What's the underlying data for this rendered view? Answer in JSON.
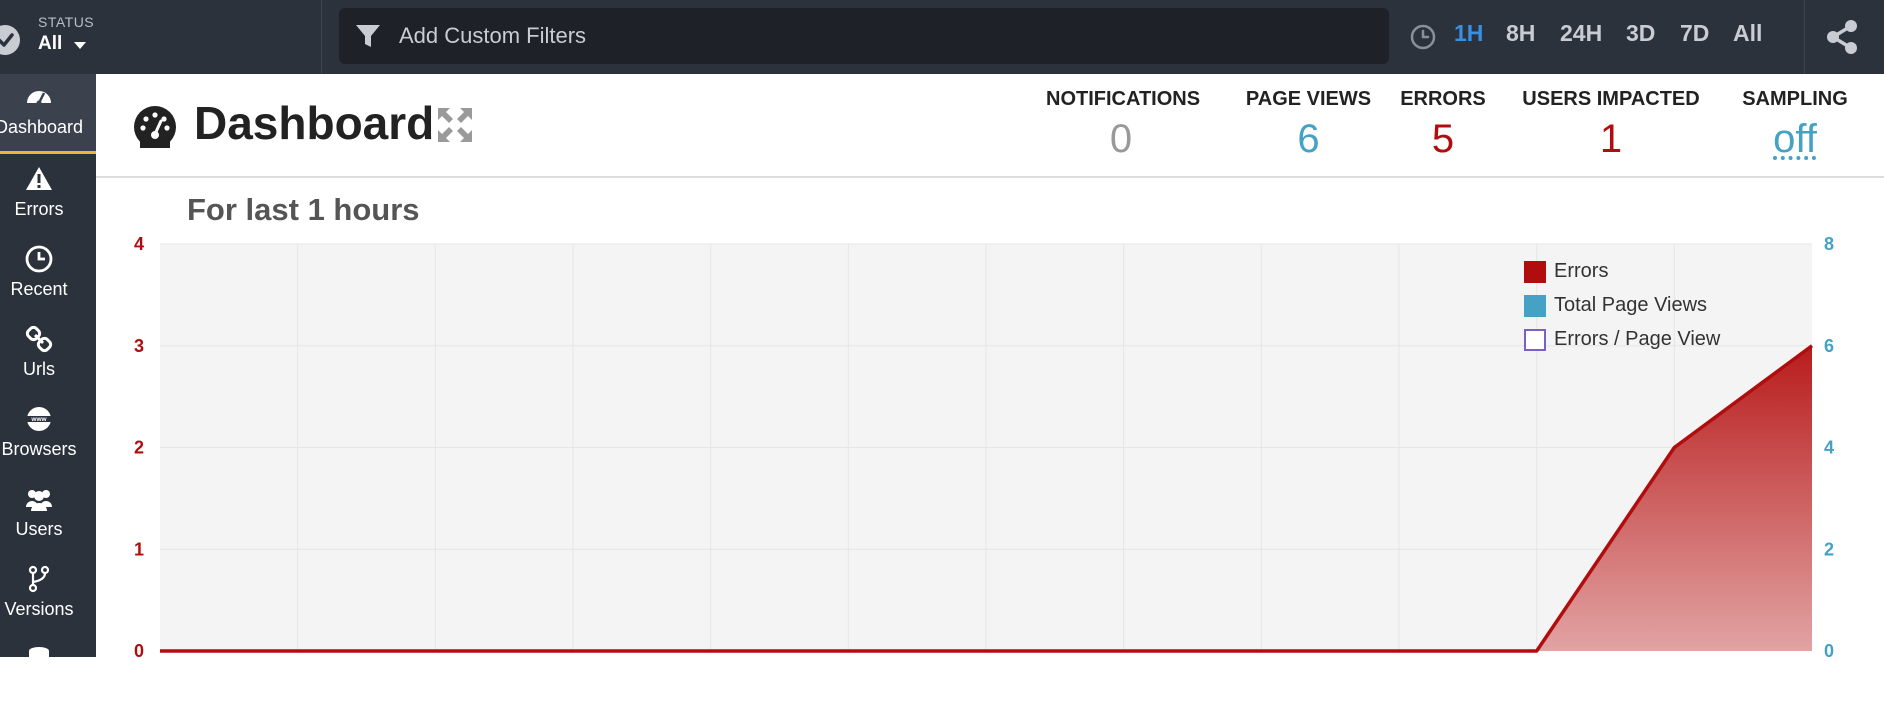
{
  "status": {
    "label": "STATUS",
    "value": "All"
  },
  "filter": {
    "placeholder": "Add Custom Filters"
  },
  "time_ranges": [
    {
      "label": "1H",
      "active": true
    },
    {
      "label": "8H",
      "active": false
    },
    {
      "label": "24H",
      "active": false
    },
    {
      "label": "3D",
      "active": false
    },
    {
      "label": "7D",
      "active": false
    },
    {
      "label": "All",
      "active": false
    }
  ],
  "sidebar": {
    "items": [
      {
        "label": "Dashboard",
        "icon": "gauge-icon",
        "active": true
      },
      {
        "label": "Errors",
        "icon": "warning-icon",
        "active": false
      },
      {
        "label": "Recent",
        "icon": "clock-icon",
        "active": false
      },
      {
        "label": "Urls",
        "icon": "link-icon",
        "active": false
      },
      {
        "label": "Browsers",
        "icon": "www-globe-icon",
        "active": false
      },
      {
        "label": "Users",
        "icon": "users-icon",
        "active": false
      },
      {
        "label": "Versions",
        "icon": "branch-icon",
        "active": false
      },
      {
        "label": "",
        "icon": "database-icon",
        "active": false
      }
    ]
  },
  "header": {
    "title": "Dashboard",
    "stats": [
      {
        "label": "NOTIFICATIONS",
        "value": "0",
        "color": "#999999"
      },
      {
        "label": "PAGE VIEWS",
        "value": "6",
        "color": "#45a2c4"
      },
      {
        "label": "ERRORS",
        "value": "5",
        "color": "#b00e0e"
      },
      {
        "label": "USERS IMPACTED",
        "value": "1",
        "color": "#b00e0e"
      },
      {
        "label": "SAMPLING",
        "value": "off",
        "color": "#45a2c4"
      }
    ]
  },
  "colors": {
    "topbar": "#2c323c",
    "accent_blue": "#3a8fe0",
    "errors_red": "#b00e0e",
    "page_views_blue": "#45a2c4",
    "ratio_purple": "#7b5fc7",
    "active_underline": "#f0b43a"
  },
  "chart_data": {
    "type": "area",
    "title": "For last 1 hours",
    "x_intervals": 12,
    "y_left": {
      "range": [
        0,
        4
      ],
      "ticks": [
        0,
        1,
        2,
        3,
        4
      ],
      "color": "#b00e0e"
    },
    "y_right": {
      "range": [
        0,
        8
      ],
      "ticks": [
        0,
        2,
        4,
        6,
        8
      ],
      "color": "#45a2c4"
    },
    "legend_position": "top-right",
    "grid": true,
    "legend": [
      {
        "name": "Errors",
        "color": "#b00e0e",
        "style": "filled"
      },
      {
        "name": "Total Page Views",
        "color": "#45a2c4",
        "style": "filled"
      },
      {
        "name": "Errors / Page View",
        "color": "#7b5fc7",
        "style": "outline"
      }
    ],
    "series": [
      {
        "name": "Errors",
        "axis": "left",
        "values": [
          0,
          0,
          0,
          0,
          0,
          0,
          0,
          0,
          0,
          0,
          0,
          2,
          3
        ]
      }
    ]
  }
}
